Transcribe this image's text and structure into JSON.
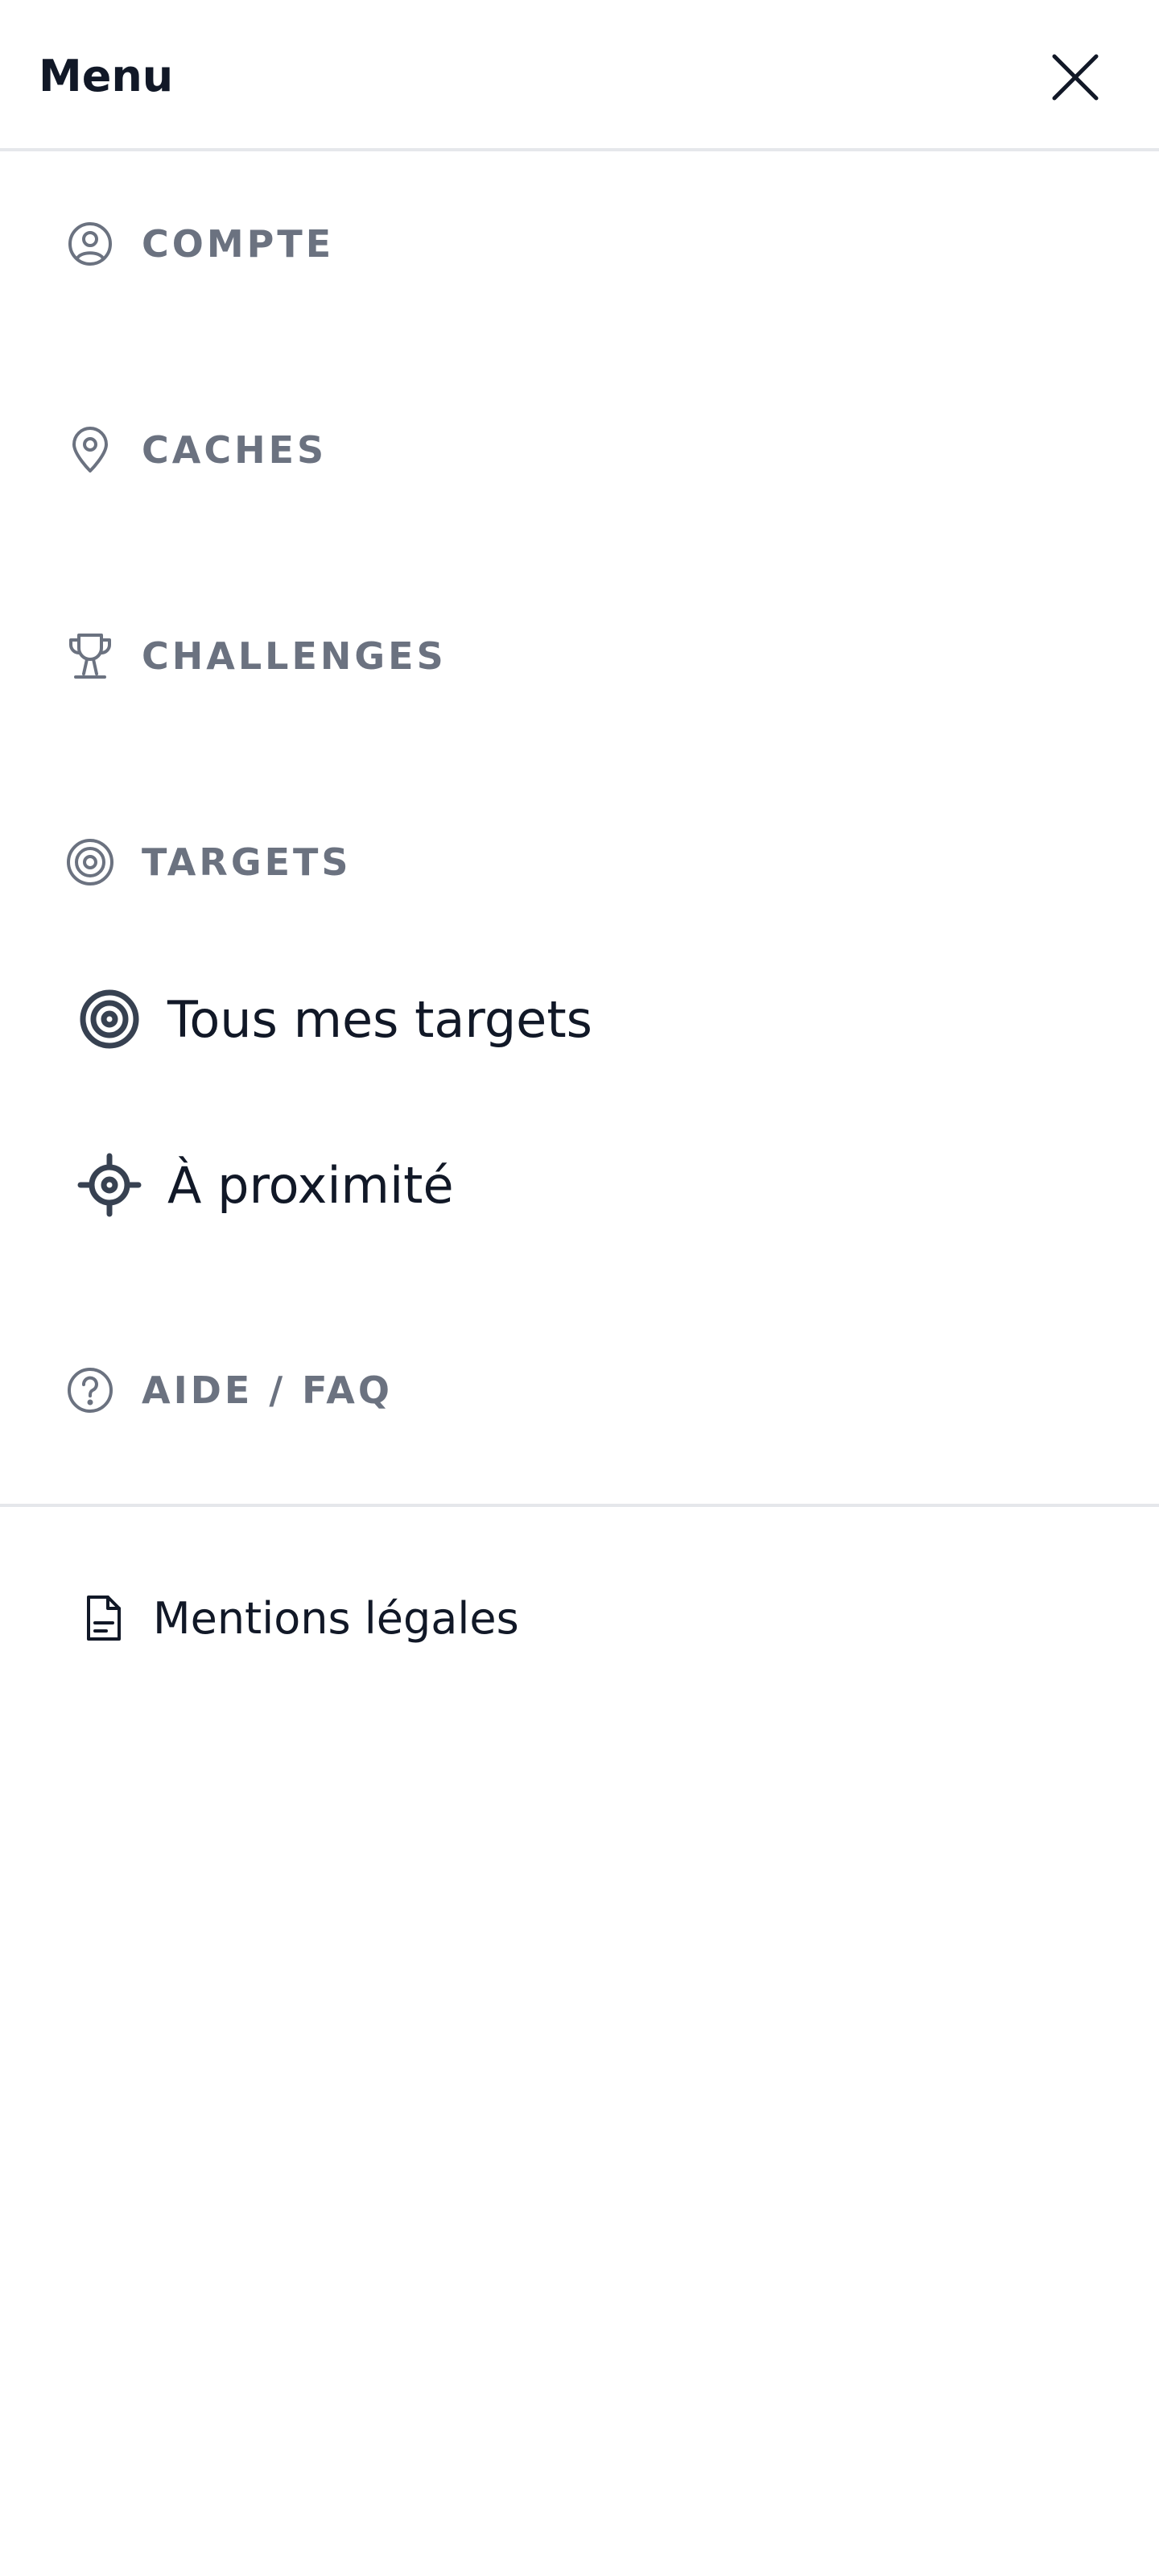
{
  "header": {
    "title": "Menu",
    "close_icon": "close-icon"
  },
  "sections": {
    "compte": {
      "label": "COMPTE",
      "icon": "user-circle-icon"
    },
    "caches": {
      "label": "CACHES",
      "icon": "map-pin-icon"
    },
    "challenges": {
      "label": "CHALLENGES",
      "icon": "trophy-icon"
    },
    "targets": {
      "label": "TARGETS",
      "icon": "target-icon",
      "items": [
        {
          "label": "Tous mes targets",
          "icon": "target-icon"
        },
        {
          "label": "À proximité",
          "icon": "crosshair-icon"
        }
      ]
    },
    "aide": {
      "label": "AIDE / FAQ",
      "icon": "help-circle-icon"
    }
  },
  "footer": {
    "legal_label": "Mentions légales",
    "legal_icon": "document-icon"
  },
  "colors": {
    "section_label": "#6b7280",
    "item_text": "#111827",
    "divider": "#e5e7eb",
    "icon_dark": "#374151"
  }
}
